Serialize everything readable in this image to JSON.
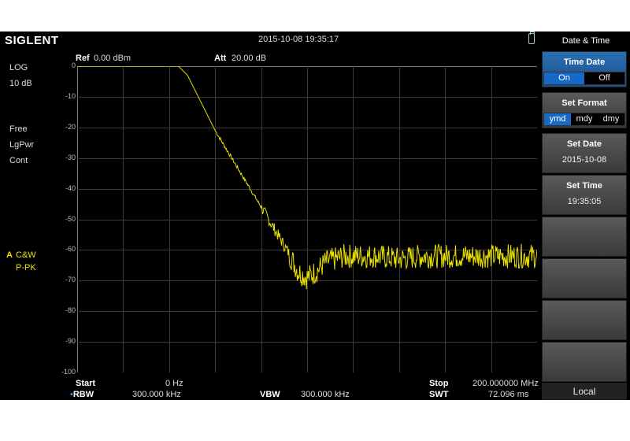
{
  "header": {
    "brand": "SIGLENT",
    "datetime": "2015-10-08   19:35:17"
  },
  "left_panel": {
    "scale_type": "LOG",
    "scale_div": "10 dB",
    "mode": "Free",
    "avg_type": "LgPwr",
    "sweep": "Cont",
    "trace_letter": "A",
    "trace_mode": "C&W",
    "detector": "P-PK"
  },
  "top_bar": {
    "ref_label": "Ref",
    "ref_value": "0.00 dBm",
    "att_label": "Att",
    "att_value": "20.00 dB"
  },
  "y_ticks": [
    "0",
    "-10",
    "-20",
    "-30",
    "-40",
    "-50",
    "-60",
    "-70",
    "-80",
    "-90",
    "-100"
  ],
  "bottom": {
    "start_label": "Start",
    "start_value": "0 Hz",
    "stop_label": "Stop",
    "stop_value": "200.000000 MHz",
    "rbw_label": "RBW",
    "rbw_value": "300.000 kHz",
    "vbw_label": "VBW",
    "vbw_value": "300.000 kHz",
    "swt_label": "SWT",
    "swt_value": "72.096 ms"
  },
  "menu": {
    "title": "Date & Time",
    "time_date": {
      "label": "Time Date",
      "options": [
        "On",
        "Off"
      ],
      "selected": "On"
    },
    "set_format": {
      "label": "Set Format",
      "options": [
        "ymd",
        "mdy",
        "dmy"
      ],
      "selected": "ymd"
    },
    "set_date": {
      "label": "Set Date",
      "value": "2015-10-08"
    },
    "set_time": {
      "label": "Set Time",
      "value": "19:35:05"
    },
    "local": "Local"
  },
  "colors": {
    "trace": "#e8e000",
    "grid": "#3a3a3a",
    "accent": "#1769c7"
  },
  "chart_data": {
    "type": "line",
    "x_range_hz": [
      0,
      200000000
    ],
    "y_range_dbm": [
      -100,
      0
    ],
    "series": [
      {
        "x_mhz": [
          0,
          40,
          44,
          48,
          52,
          56,
          60,
          64,
          68,
          72,
          76,
          80,
          84,
          88,
          92,
          96,
          100,
          104,
          108,
          112,
          116,
          120,
          130,
          140,
          150,
          160,
          170,
          180,
          190,
          200
        ],
        "y_dbm": [
          0,
          0,
          0,
          -3,
          -9,
          -15,
          -21,
          -26,
          -31,
          -36,
          -41,
          -46,
          -51,
          -56,
          -61,
          -67,
          -69,
          -67,
          -64,
          -63,
          -62,
          -62,
          -62,
          -63,
          -62,
          -62,
          -62,
          -62,
          -62,
          -62
        ]
      }
    ]
  }
}
